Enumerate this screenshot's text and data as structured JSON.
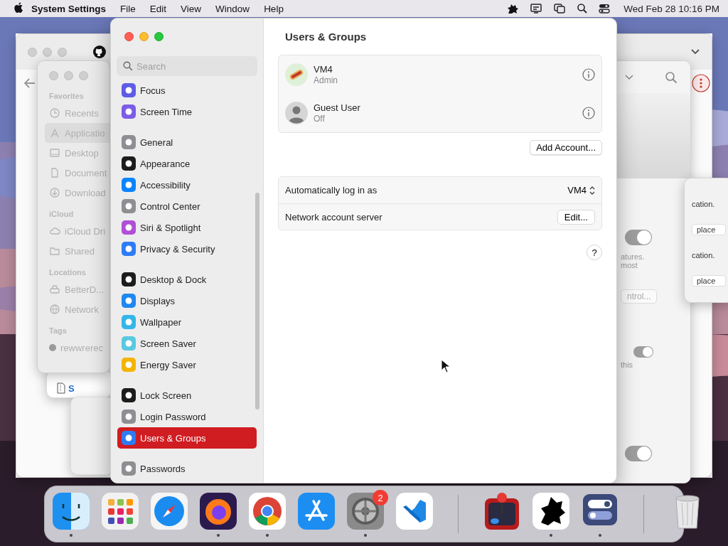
{
  "menu_bar": {
    "app_name": "System Settings",
    "menus": [
      "File",
      "Edit",
      "View",
      "Window",
      "Help"
    ],
    "clock": "Wed Feb 28  10:16 PM"
  },
  "finder": {
    "sections": [
      {
        "heading": "Favorites",
        "items": [
          {
            "kind": "clock",
            "label": "Recents",
            "selected": false
          },
          {
            "kind": "apps",
            "label": "Applicatio",
            "selected": true
          },
          {
            "kind": "desktop",
            "label": "Desktop",
            "selected": false
          },
          {
            "kind": "doc",
            "label": "Document",
            "selected": false
          },
          {
            "kind": "download",
            "label": "Download",
            "selected": false
          }
        ]
      },
      {
        "heading": "iCloud",
        "items": [
          {
            "kind": "cloud",
            "label": "iCloud Dri",
            "selected": false
          },
          {
            "kind": "folder",
            "label": "Shared",
            "selected": false
          }
        ]
      },
      {
        "heading": "Locations",
        "items": [
          {
            "kind": "drive",
            "label": "BetterD...",
            "selected": false
          },
          {
            "kind": "globe",
            "label": "Network",
            "selected": false
          }
        ]
      },
      {
        "heading": "Tags",
        "items": [
          {
            "kind": "tag",
            "label": "rewwrerec",
            "selected": false,
            "color": "#9a9a9a"
          }
        ]
      }
    ]
  },
  "file_strip": {
    "label": "S"
  },
  "side_window": {
    "toggles": [
      {
        "on": true
      },
      {
        "on": true
      },
      {
        "on": true
      }
    ],
    "text_a": "atures.",
    "text_b": "most",
    "button": "ntrol...",
    "text_c": "this"
  },
  "front_strip": {
    "rows": [
      {
        "text": "cation.",
        "button": "place"
      },
      {
        "text": "cation.",
        "button": "place"
      }
    ]
  },
  "settings": {
    "search": {
      "placeholder": "Search"
    },
    "sidebar": [
      {
        "items": [
          {
            "label": "Focus",
            "color": "#5e5ce6",
            "selected": false
          },
          {
            "label": "Screen Time",
            "color": "#7d5ce6",
            "selected": false
          }
        ]
      },
      {
        "items": [
          {
            "label": "General",
            "color": "#8e8e93",
            "selected": false
          },
          {
            "label": "Appearance",
            "color": "#1c1c1e",
            "selected": false
          },
          {
            "label": "Accessibility",
            "color": "#0a84ff",
            "selected": false
          },
          {
            "label": "Control Center",
            "color": "#8e8e93",
            "selected": false
          },
          {
            "label": "Siri & Spotlight",
            "color": "#b04fd8",
            "selected": false
          },
          {
            "label": "Privacy & Security",
            "color": "#2d7cf6",
            "selected": false
          }
        ]
      },
      {
        "items": [
          {
            "label": "Desktop & Dock",
            "color": "#1c1c1e",
            "selected": false
          },
          {
            "label": "Displays",
            "color": "#1e88f0",
            "selected": false
          },
          {
            "label": "Wallpaper",
            "color": "#35b6e8",
            "selected": false
          },
          {
            "label": "Screen Saver",
            "color": "#5ac8e0",
            "selected": false
          },
          {
            "label": "Energy Saver",
            "color": "#f5b400",
            "selected": false
          }
        ]
      },
      {
        "items": [
          {
            "label": "Lock Screen",
            "color": "#1c1c1e",
            "selected": false
          },
          {
            "label": "Login Password",
            "color": "#8e8e93",
            "selected": false
          },
          {
            "label": "Users & Groups",
            "color": "#2d7cf6",
            "selected": true
          }
        ]
      },
      {
        "items": [
          {
            "label": "Passwords",
            "color": "#8e8e93",
            "selected": false
          }
        ]
      }
    ],
    "title": "Users & Groups",
    "users": [
      {
        "kind": "custom",
        "name": "VM4",
        "role": "Admin"
      },
      {
        "kind": "guest",
        "name": "Guest User",
        "role": "Off"
      }
    ],
    "add_button": "Add Account...",
    "options": [
      {
        "kind": "popup",
        "label": "Automatically log in as",
        "value": "VM4"
      },
      {
        "kind": "button",
        "label": "Network account server",
        "value": "Edit..."
      }
    ],
    "help": "?"
  },
  "dock": {
    "apps": [
      {
        "kind": "finder",
        "running": true
      },
      {
        "kind": "launchpad",
        "running": false
      },
      {
        "kind": "compass",
        "running": false
      },
      {
        "kind": "firefox",
        "running": true
      },
      {
        "kind": "chrome",
        "running": true
      },
      {
        "kind": "store",
        "running": false
      },
      {
        "kind": "settings",
        "running": true,
        "badge": "2"
      },
      {
        "kind": "code",
        "running": false
      }
    ],
    "recent": [
      {
        "kind": "joystick",
        "running": false
      },
      {
        "kind": "silhouette",
        "running": true
      },
      {
        "kind": "toggles",
        "running": true
      }
    ],
    "trash": {
      "kind": "trash",
      "running": false
    }
  }
}
